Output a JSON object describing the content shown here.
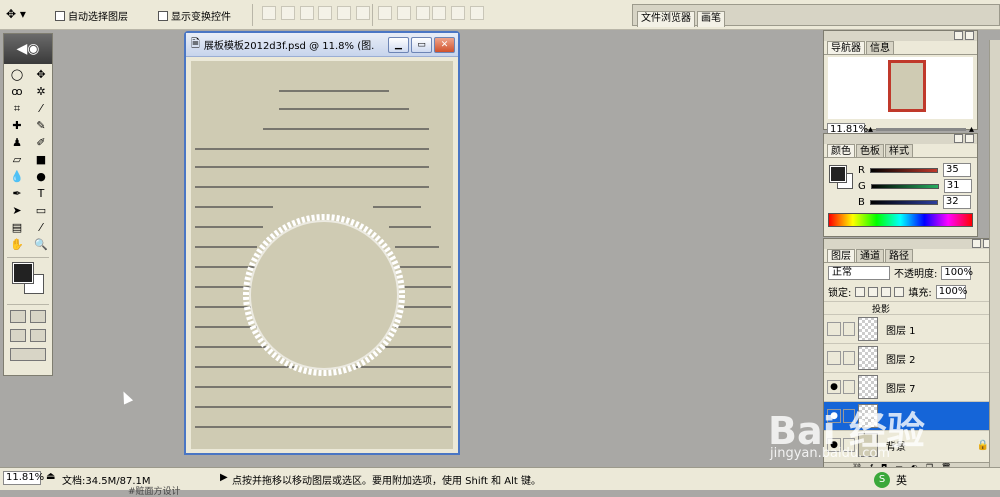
{
  "options_bar": {
    "tool_icon": "move-tool-icon",
    "auto_select_label": "自动选择图层",
    "show_bounds_label": "显示变换控件",
    "panel_well_tabs": [
      "文件浏览器",
      "画笔"
    ]
  },
  "tools_palette": {
    "tools": [
      "marquee",
      "move",
      "lasso",
      "magic-wand",
      "crop",
      "slice",
      "healing-brush",
      "brush",
      "clone-stamp",
      "history-brush",
      "eraser",
      "gradient",
      "blur",
      "dodge",
      "pen",
      "type",
      "path-selection",
      "shape",
      "notes",
      "eyedropper",
      "hand",
      "zoom"
    ],
    "foreground_color": "#222222",
    "background_color": "#ffffff"
  },
  "document": {
    "title": "展板模板2012d3f.psd @ 11.8% (图...",
    "canvas_color": "#cfcbb3"
  },
  "navigator": {
    "tabs": [
      "导航器",
      "信息"
    ],
    "zoom": "11.81%"
  },
  "color_panel": {
    "tabs": [
      "颜色",
      "色板",
      "样式"
    ],
    "channels": [
      {
        "label": "R",
        "value": "35",
        "color": "#c0392b"
      },
      {
        "label": "G",
        "value": "31",
        "color": "#27ae60"
      },
      {
        "label": "B",
        "value": "32",
        "color": "#2c3e9e"
      }
    ]
  },
  "layers_panel": {
    "tabs": [
      "图层",
      "通道",
      "路径"
    ],
    "blend_mode": "正常",
    "opacity_label": "不透明度:",
    "opacity": "100%",
    "lock_label": "锁定:",
    "fill_label": "填充:",
    "fill": "100%",
    "effect_label": "投影",
    "layers": [
      {
        "name": "图层 1",
        "visible": false,
        "selected": false
      },
      {
        "name": "图层 2",
        "visible": false,
        "selected": false
      },
      {
        "name": "图层 7",
        "visible": true,
        "selected": false
      },
      {
        "name": "",
        "visible": true,
        "selected": true
      },
      {
        "name": "背景",
        "visible": true,
        "selected": false,
        "locked": true
      }
    ]
  },
  "status_bar": {
    "zoom": "11.81%",
    "doc_info": "文档:34.5M/87.1M",
    "hint": "点按并拖移以移动图层或选区。要用附加选项，使用 Shift 和 Alt 键。",
    "taskbar_text": "#赃面方设计"
  },
  "watermark": {
    "logo_text": "Bai 经验",
    "url": "jingyan.baidu.com"
  },
  "tray": {
    "ime_label": "英"
  }
}
